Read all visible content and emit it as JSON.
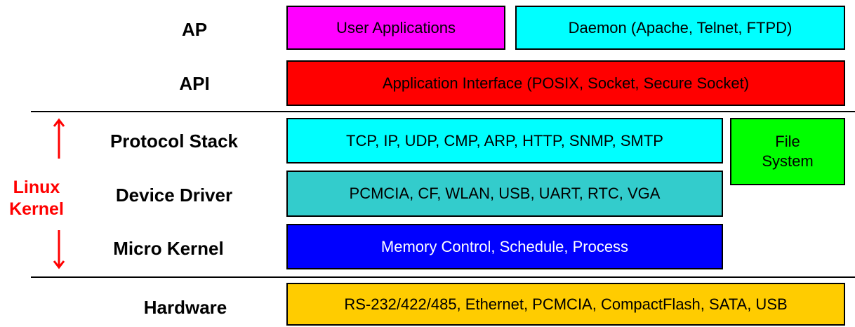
{
  "layers": {
    "ap": {
      "label": "AP",
      "boxes": [
        {
          "text": "User Applications",
          "color": "#ff00ff"
        },
        {
          "text": "Daemon (Apache, Telnet, FTPD)",
          "color": "#00ffff"
        }
      ]
    },
    "api": {
      "label": "API",
      "box": {
        "text": "Application Interface (POSIX, Socket, Secure Socket)",
        "color": "#ff0000"
      }
    },
    "protocol_stack": {
      "label": "Protocol Stack",
      "box": {
        "text": "TCP, IP, UDP, CMP, ARP, HTTP, SNMP, SMTP",
        "color": "#00ffff"
      }
    },
    "file_system": {
      "line1": "File",
      "line2": "System",
      "color": "#00ff00"
    },
    "device_driver": {
      "label": "Device Driver",
      "box": {
        "text": "PCMCIA, CF, WLAN, USB, UART, RTC, VGA",
        "color": "#33cccc"
      }
    },
    "micro_kernel": {
      "label": "Micro Kernel",
      "box": {
        "text": "Memory Control, Schedule, Process",
        "color": "#0000ff"
      }
    },
    "hardware": {
      "label": "Hardware",
      "box": {
        "text": "RS-232/422/485, Ethernet, PCMCIA, CompactFlash, SATA, USB",
        "color": "#ffcc00"
      }
    }
  },
  "linux_kernel": {
    "line1": "Linux",
    "line2": "Kernel",
    "color": "#ff0000"
  }
}
